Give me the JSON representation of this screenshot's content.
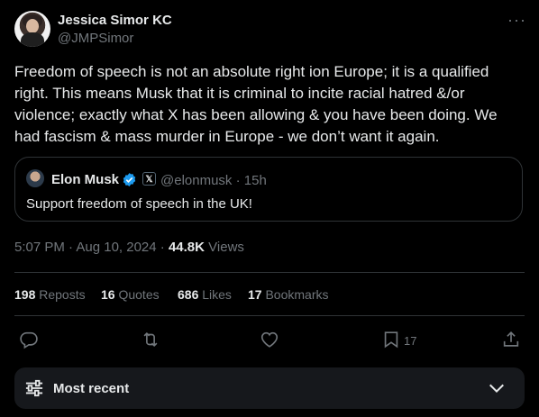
{
  "author": {
    "name": "Jessica Simor KC",
    "handle": "@JMPSimor"
  },
  "tweet": {
    "text": "Freedom of speech is not an absolute right ion Europe; it is a qualified right. This means Musk that it is criminal to incite racial hatred &/or violence; exactly what X has been allowing & you have been doing. We had fascism & mass murder in Europe - we don’t want it again."
  },
  "quote": {
    "name": "Elon Musk",
    "handle": "@elonmusk",
    "sep": "·",
    "time": "15h",
    "text": "Support freedom of speech in the UK!"
  },
  "meta": {
    "datetime": "5:07 PM · Aug 10, 2024 ·",
    "views_count": "44.8K",
    "views_label": "Views"
  },
  "stats": {
    "reposts_count": "198",
    "reposts_label": "Reposts",
    "quotes_count": "16",
    "quotes_label": "Quotes",
    "likes_count": "686",
    "likes_label": "Likes",
    "bookmarks_count": "17",
    "bookmarks_label": "Bookmarks"
  },
  "actions": {
    "bookmark_count": "17"
  },
  "sort": {
    "label": "Most recent"
  },
  "colors": {
    "background": "#000000",
    "text": "#e7e9ea",
    "muted": "#71767b",
    "verified": "#1d9bf0",
    "border": "#2f3336"
  }
}
